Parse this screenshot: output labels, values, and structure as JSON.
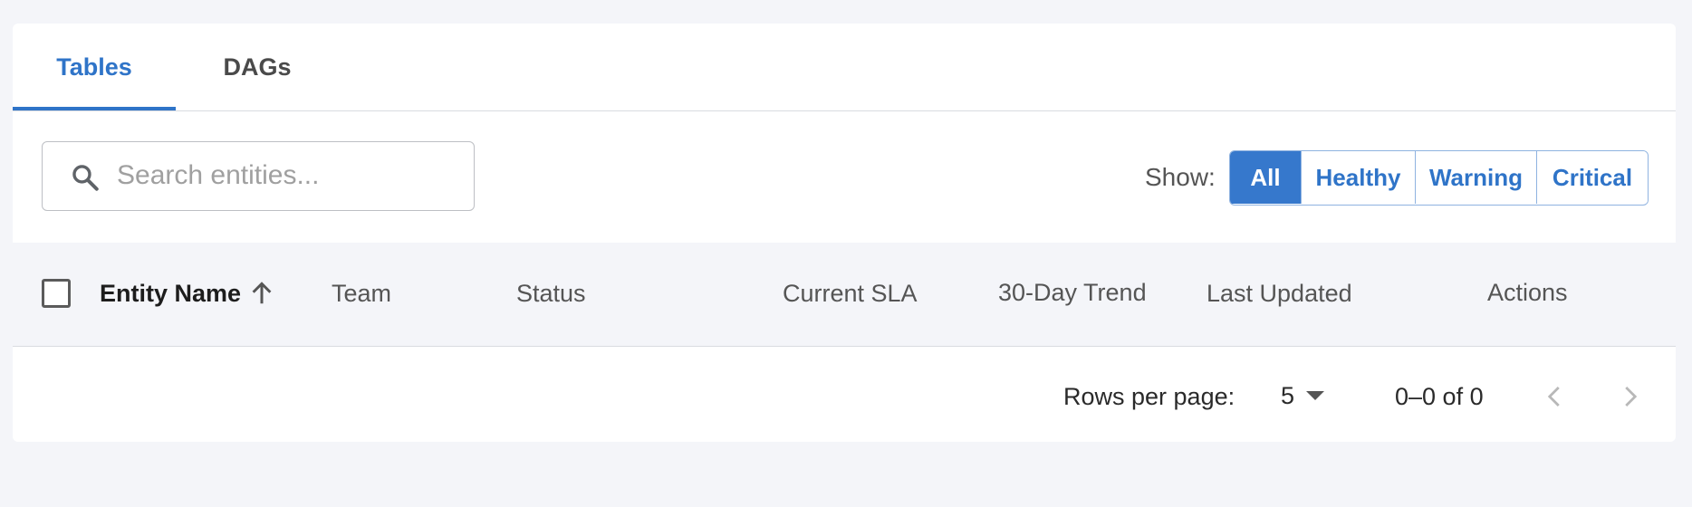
{
  "tabs": [
    {
      "label": "Tables",
      "active": true
    },
    {
      "label": "DAGs",
      "active": false
    }
  ],
  "search": {
    "placeholder": "Search entities...",
    "value": "",
    "icon": "search-icon"
  },
  "filter": {
    "label": "Show:",
    "options": [
      {
        "label": "All",
        "active": true
      },
      {
        "label": "Healthy",
        "active": false
      },
      {
        "label": "Warning",
        "active": false
      },
      {
        "label": "Critical",
        "active": false
      }
    ]
  },
  "table": {
    "columns": [
      {
        "label": "Entity Name",
        "sorted": "asc"
      },
      {
        "label": "Team"
      },
      {
        "label": "Status"
      },
      {
        "label": "Current SLA"
      },
      {
        "label": "30-Day Trend"
      },
      {
        "label": "Last Updated"
      },
      {
        "label": "Actions"
      }
    ],
    "rows": []
  },
  "pagination": {
    "rows_per_page_label": "Rows per page:",
    "rows_per_page": "5",
    "range": "0–0 of 0",
    "prev_disabled": true,
    "next_disabled": true
  },
  "colors": {
    "accent": "#2f74c8",
    "background": "#f4f5f9",
    "card": "#ffffff"
  }
}
